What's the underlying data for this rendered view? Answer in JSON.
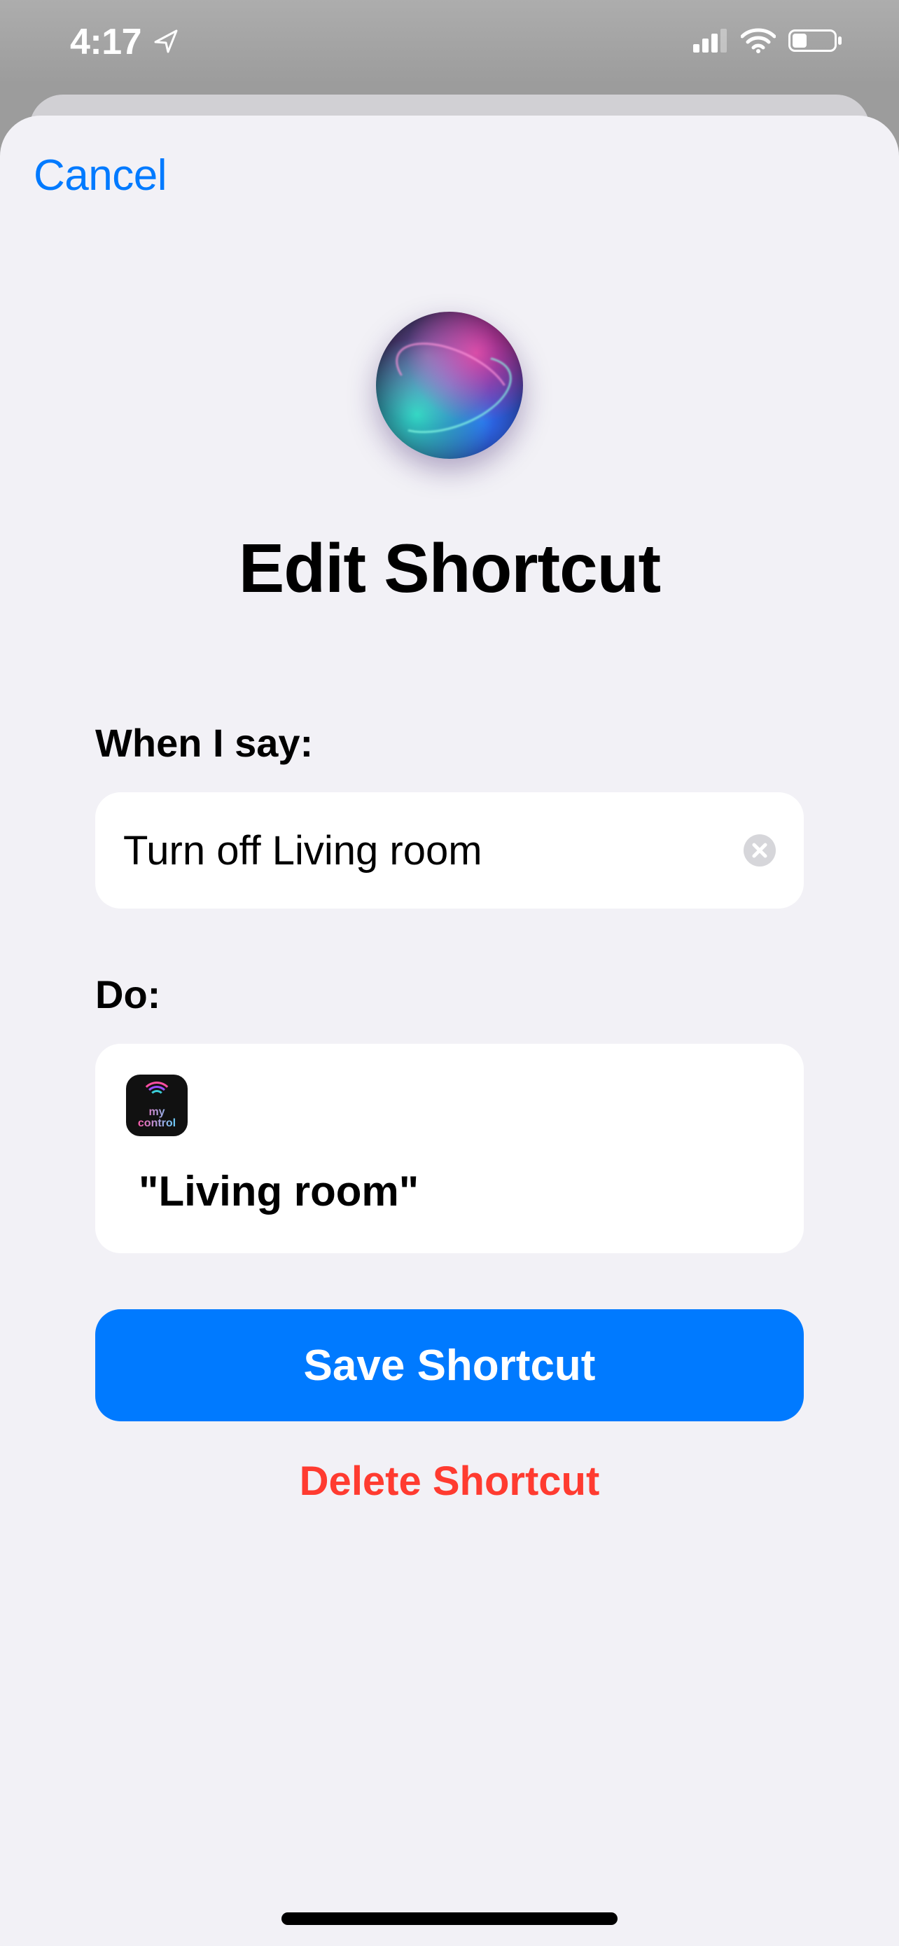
{
  "status": {
    "time": "4:17",
    "location_icon": "location-arrow",
    "cellular_bars": 3,
    "wifi": true,
    "battery_percent": 30
  },
  "nav": {
    "cancel_label": "Cancel"
  },
  "hero": {
    "icon": "siri-orb",
    "title": "Edit Shortcut"
  },
  "phrase": {
    "label": "When I say:",
    "value": "Turn off Living room",
    "clear_icon": "clear-circle"
  },
  "action": {
    "label": "Do:",
    "app": {
      "name": "my control",
      "line1": "my",
      "line2": "control"
    },
    "description": "\"Living room\""
  },
  "buttons": {
    "save_label": "Save Shortcut",
    "delete_label": "Delete Shortcut"
  }
}
